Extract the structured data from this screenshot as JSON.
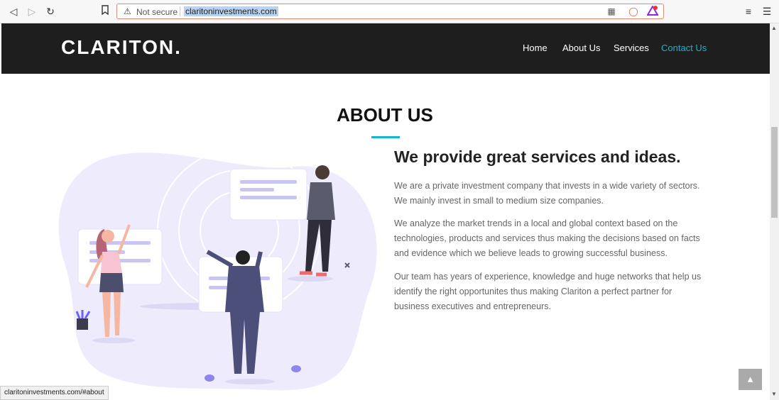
{
  "browser": {
    "not_secure": "Not secure",
    "url": "claritoninvestments.com",
    "status_url": "claritoninvestments.com/#about"
  },
  "site": {
    "logo": "CLARITON.",
    "nav": [
      "Home",
      "About Us",
      "Services",
      "Contact Us"
    ],
    "active_nav": "Contact Us"
  },
  "about": {
    "title": "ABOUT US",
    "headline": "We provide great services and ideas.",
    "paragraphs": [
      "We are a private investment company that invests in a wide variety of sectors. We mainly invest in small to medium size companies.",
      "We analyze the market trends in a local and global context based on the technologies, products and services thus making the decisions based on facts and evidence which we believe leads to growing successful business.",
      "Our team has years of experience, knowledge and huge networks that help us identify the right opportunites thus making Clariton a perfect partner for business executives and entrepreneurs."
    ]
  },
  "colors": {
    "header_bg": "#1e1e1e",
    "accent": "#18b4cf",
    "blob": "#eeecfc"
  },
  "icons": [
    "back-arrow-icon",
    "forward-arrow-icon",
    "reload-icon",
    "bookmark-icon",
    "warning-icon",
    "qr-icon",
    "brave-shield-icon",
    "brave-rewards-icon",
    "playlist-icon",
    "menu-icon",
    "chevron-up-icon"
  ]
}
